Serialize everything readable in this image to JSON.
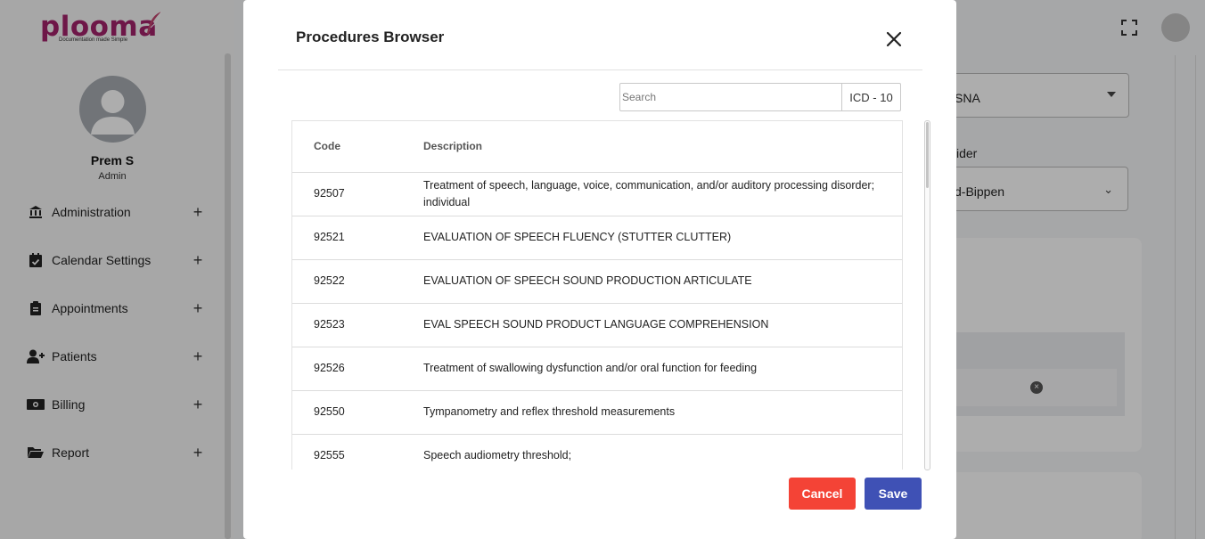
{
  "app": {
    "logo_text": "plooma",
    "logo_tagline": "Documentation made Simple",
    "colors": {
      "brand": "#a3236b",
      "cancel": "#f44336",
      "save": "#3f51b5"
    }
  },
  "sidebar": {
    "user_name": "Prem S",
    "user_role": "Admin",
    "items": [
      {
        "label": "Administration",
        "icon": "bank-icon"
      },
      {
        "label": "Calendar Settings",
        "icon": "calendar-check-icon"
      },
      {
        "label": "Appointments",
        "icon": "clipboard-icon"
      },
      {
        "label": "Patients",
        "icon": "user-plus-icon"
      },
      {
        "label": "Billing",
        "icon": "money-icon"
      },
      {
        "label": "Report",
        "icon": "folder-open-icon"
      }
    ],
    "expand_symbol": "+"
  },
  "background": {
    "select1_value": "SNA",
    "label": "vider",
    "select2_value": "d-Bippen"
  },
  "modal": {
    "title": "Procedures Browser",
    "search_placeholder": "Search",
    "code_type": "ICD - 10",
    "columns": {
      "code": "Code",
      "description": "Description"
    },
    "rows": [
      {
        "code": "92507",
        "description": "Treatment of speech, language, voice, communication, and/or auditory processing disorder; individual"
      },
      {
        "code": "92521",
        "description": "EVALUATION OF SPEECH FLUENCY (STUTTER CLUTTER)"
      },
      {
        "code": "92522",
        "description": "EVALUATION OF SPEECH SOUND PRODUCTION ARTICULATE"
      },
      {
        "code": "92523",
        "description": "EVAL SPEECH SOUND PRODUCT LANGUAGE COMPREHENSION"
      },
      {
        "code": "92526",
        "description": "Treatment of swallowing dysfunction and/or oral function for feeding"
      },
      {
        "code": "92550",
        "description": "Tympanometry and reflex threshold measurements"
      },
      {
        "code": "92555",
        "description": "Speech audiometry threshold;"
      }
    ],
    "cancel_label": "Cancel",
    "save_label": "Save"
  }
}
